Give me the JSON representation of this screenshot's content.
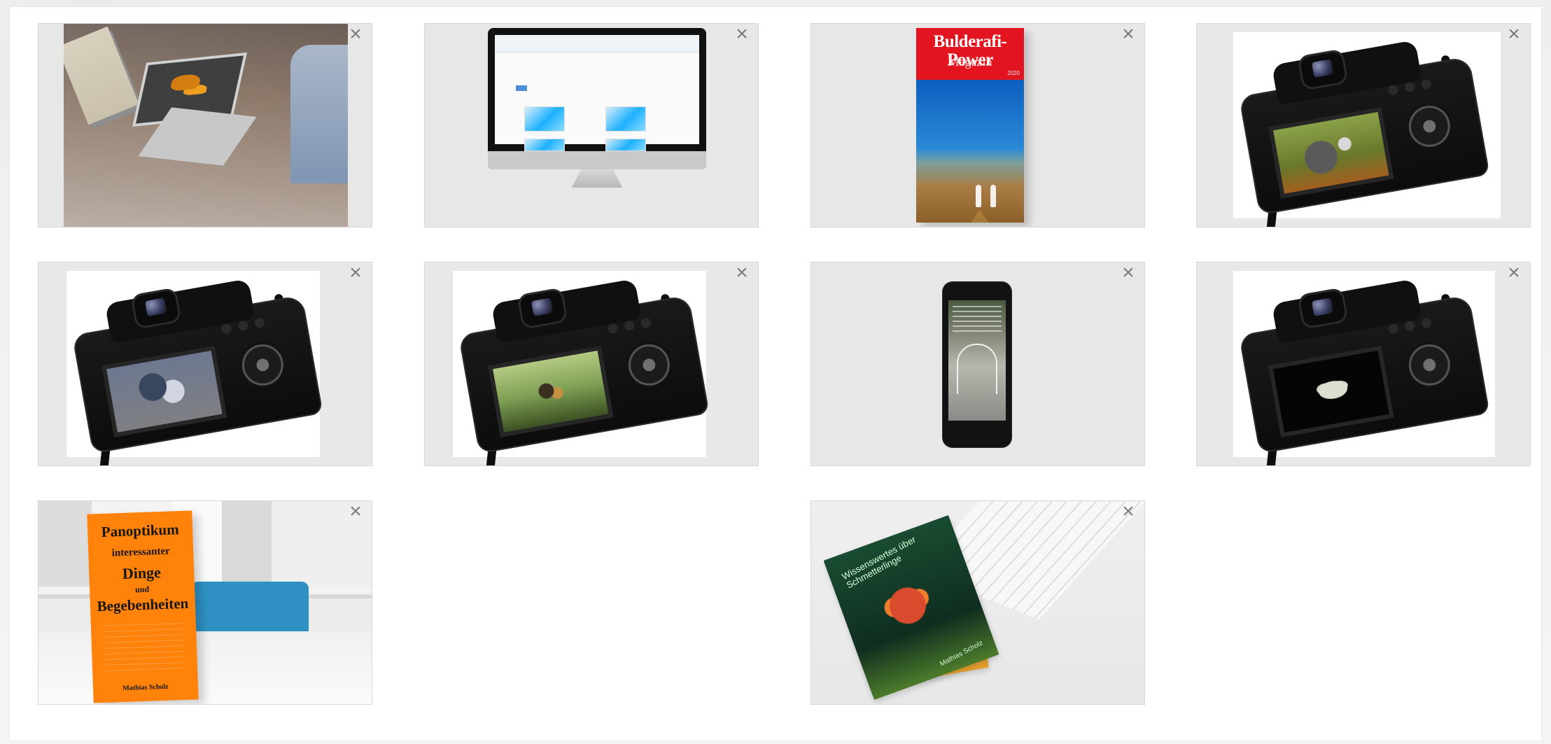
{
  "gallery": {
    "items": [
      {
        "close_label": "×",
        "type": "laptop-photo"
      },
      {
        "close_label": "×",
        "type": "monitor-mockup"
      },
      {
        "close_label": "×",
        "type": "magazine-cover",
        "title": "Bulderafi-Power",
        "subtitle": "Magazin",
        "small_text": "2020"
      },
      {
        "close_label": "×",
        "type": "camera-wasp"
      },
      {
        "close_label": "×",
        "type": "camera-fly"
      },
      {
        "close_label": "×",
        "type": "camera-hoverfly"
      },
      {
        "close_label": "×",
        "type": "phone-mockup"
      },
      {
        "close_label": "×",
        "type": "camera-moth"
      },
      {
        "close_label": "×",
        "type": "book-office",
        "title_line_1": "Panoptikum",
        "title_line_2": "interessanter",
        "title_line_3": "Dinge",
        "title_line_4": "und",
        "title_line_5": "Begebenheiten",
        "author": "Mathias Scholz"
      },
      {
        "close_label": "×",
        "type": "book-stack",
        "book_title": "Wissenswertes über Schmetterlinge",
        "book_author": "Mathias Scholz"
      }
    ]
  }
}
